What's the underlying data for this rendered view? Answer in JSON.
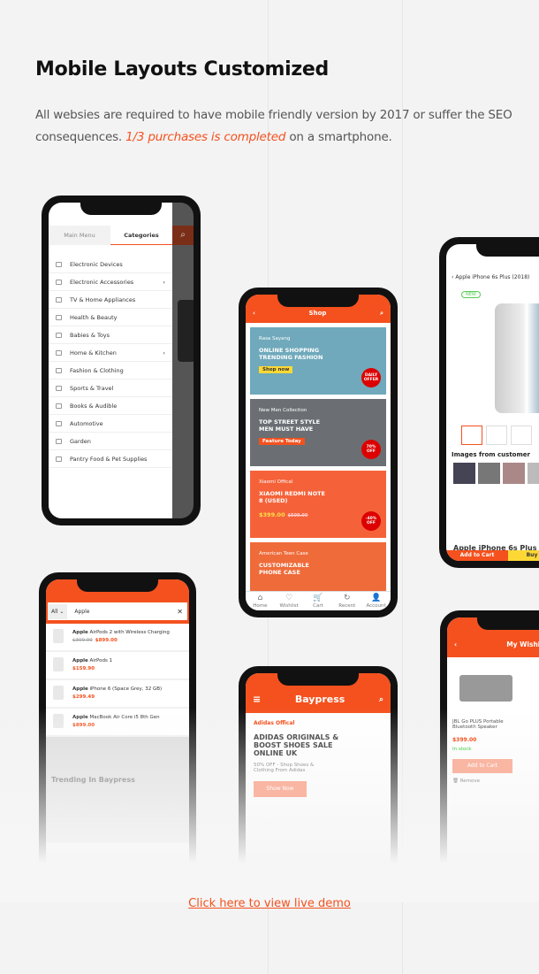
{
  "title": "Mobile Layouts Customized",
  "intro": {
    "text_before": "All websies are required to have mobile friendly version by 2017 or suffer the SEO consequences. ",
    "highlight": "1/3 purchases is completed",
    "text_after": " on a smartphone."
  },
  "accent_color": "#f4511e",
  "menu_phone": {
    "tabs": [
      "Main Menu",
      "Categories"
    ],
    "active_tab": "Categories",
    "categories": [
      {
        "label": "Electronic Devices",
        "submenu": false
      },
      {
        "label": "Electronic Accessories",
        "submenu": true
      },
      {
        "label": "TV & Home Appliances",
        "submenu": false
      },
      {
        "label": "Health & Beauty",
        "submenu": false
      },
      {
        "label": "Babies & Toys",
        "submenu": false
      },
      {
        "label": "Home & Kitchen",
        "submenu": true
      },
      {
        "label": "Fashion & Clothing",
        "submenu": false
      },
      {
        "label": "Sports & Travel",
        "submenu": false
      },
      {
        "label": "Books & Audible",
        "submenu": false
      },
      {
        "label": "Automotive",
        "submenu": false
      },
      {
        "label": "Garden",
        "submenu": false
      },
      {
        "label": "Pantry Food & Pet Supplies",
        "submenu": false
      }
    ]
  },
  "shop_phone": {
    "title": "Shop",
    "banners": [
      {
        "small": "Rasa Sayang",
        "headline": "ONLINE SHOPPING TRENDING FASHION",
        "cta": "Shop now",
        "badge": "DAILY OFFER",
        "color": "#6fa9bb"
      },
      {
        "small": "New Men Collection",
        "headline": "TOP STREET STYLE MEN MUST HAVE",
        "cta": "Feature Today",
        "badge": "70% OFF",
        "color": "#6b6f73"
      },
      {
        "small": "Xiaomi Offical",
        "headline": "XIAOMI REDMI NOTE 8 (USED)",
        "price": "$399.00",
        "old_price": "$500.00",
        "badge": "-40% OFF",
        "color": "#f5623a"
      },
      {
        "small": "American Teen Case",
        "headline": "CUSTOMIZABLE PHONE CASE",
        "color": "#ef6b3a"
      }
    ],
    "tabs": [
      "Home",
      "Wishlist",
      "Cart",
      "Recent",
      "Account"
    ],
    "cart_count": "3"
  },
  "product_phone": {
    "title": "Apple iPhone 6s Plus (2018)",
    "badge": "NEW",
    "section": "Images from customer",
    "product_name": "Apple iPhone 6s Plus (2018)",
    "add_to_cart": "Add to Cart",
    "buy": "Buy"
  },
  "search_phone": {
    "scope": "All",
    "query": "Apple",
    "results": [
      {
        "brand": "Apple",
        "name": "AirPods 2 with Wireless Charging",
        "old_price": "$309.99",
        "price": "$899.00"
      },
      {
        "brand": "Apple",
        "name": "AirPods 1",
        "price": "$159.90"
      },
      {
        "brand": "Apple",
        "name": "iPhone 6 (Space Grey, 32 GB)",
        "price": "$299.49"
      },
      {
        "brand": "Apple",
        "name": "MacBook Air Core i5 8th Gen",
        "price": "$899.00"
      }
    ],
    "section": "Trending In Baypress"
  },
  "home_phone": {
    "brand": "Baypress",
    "small": "Adidas Offical",
    "headline": "ADIDAS ORIGINALS & BOOST SHOES SALE ONLINE UK",
    "sub": "50% OFF - Shop Shoes & Clothing From Adidas",
    "cta": "Show Now"
  },
  "wishlist_phone": {
    "title": "My Wishlist",
    "item": "JBL Go PLUS Portable Bluetooth Speaker",
    "price": "$399.00",
    "stock": "In stock",
    "add_to_cart": "Add to Cart",
    "remove": "Remove"
  },
  "demo_link": "Click here to view live demo"
}
